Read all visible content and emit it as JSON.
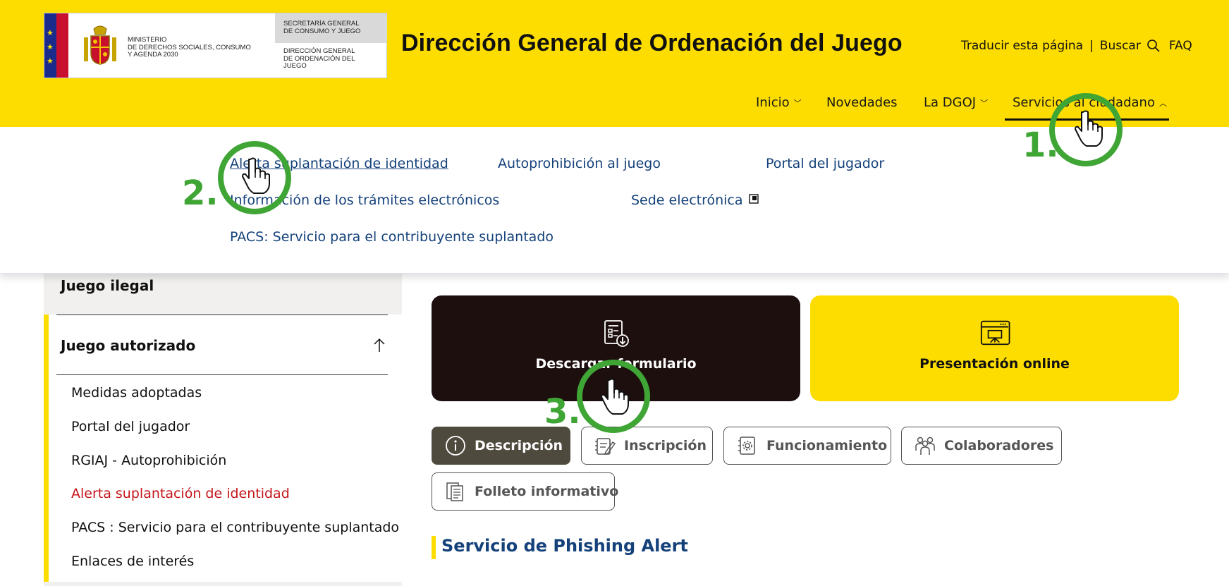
{
  "header": {
    "ministry_lines": [
      "MINISTERIO",
      "DE DERECHOS SOCIALES, CONSUMO",
      "Y AGENDA 2030"
    ],
    "secretary_lines": [
      "SECRETARÍA GENERAL",
      "DE CONSUMO Y JUEGO"
    ],
    "directorate_lines": [
      "DIRECCIÓN GENERAL",
      "DE ORDENACIÓN DEL",
      "JUEGO"
    ],
    "site_title": "Dirección General de Ordenación del Juego",
    "translate_label": "Traducir esta página",
    "separator": "|",
    "search_label": "Buscar",
    "faq_label": "FAQ"
  },
  "nav": {
    "items": [
      {
        "label": "Inicio",
        "has_chevron": true
      },
      {
        "label": "Novedades",
        "has_chevron": false
      },
      {
        "label": "La DGOJ",
        "has_chevron": true
      },
      {
        "label": "Servicios al ciudadano",
        "has_chevron": true,
        "expanded": true
      }
    ]
  },
  "dropdown": {
    "links": [
      {
        "label": "Alerta suplantación de identidad",
        "active": true
      },
      {
        "label": "Autoprohibición al juego"
      },
      {
        "label": "Portal del jugador"
      },
      {
        "label": "Información de los trámites electrónicos"
      },
      {
        "label": "Sede electrónica",
        "external": true
      },
      {
        "label": "PACS: Servicio para el contribuyente suplantado"
      }
    ]
  },
  "sidebar": {
    "section_ilegal": "Juego ilegal",
    "section_autorizado": "Juego autorizado",
    "items": [
      {
        "label": "Medidas adoptadas"
      },
      {
        "label": "Portal del jugador"
      },
      {
        "label": "RGIAJ - Autoprohibición"
      },
      {
        "label": "Alerta suplantación de identidad",
        "current": true
      },
      {
        "label": "PACS : Servicio para el contribuyente suplantado"
      },
      {
        "label": "Enlaces de interés"
      }
    ]
  },
  "cards": {
    "download": {
      "label": "Descargar formulario",
      "icon": "form-download-icon"
    },
    "online": {
      "label": "Presentación online",
      "icon": "presentation-screen-icon"
    }
  },
  "tabs": [
    {
      "label": "Descripción",
      "icon": "info-icon",
      "active": true
    },
    {
      "label": "Inscripción",
      "icon": "notepad-pencil-icon"
    },
    {
      "label": "Funcionamiento",
      "icon": "gear-notebook-icon"
    },
    {
      "label": "Colaboradores",
      "icon": "people-group-icon"
    },
    {
      "label": "Folleto informativo",
      "icon": "document-pages-icon"
    }
  ],
  "section_title": "Servicio de Phishing Alert",
  "annotations": [
    "1.",
    "2.",
    "3."
  ],
  "colors": {
    "brand_yellow": "#fddd00",
    "link_blue": "#14417a",
    "active_red": "#c4161c",
    "annotation_green": "#3fa535",
    "dark_card": "#1e0f0f",
    "active_tab": "#4f4a3e"
  }
}
